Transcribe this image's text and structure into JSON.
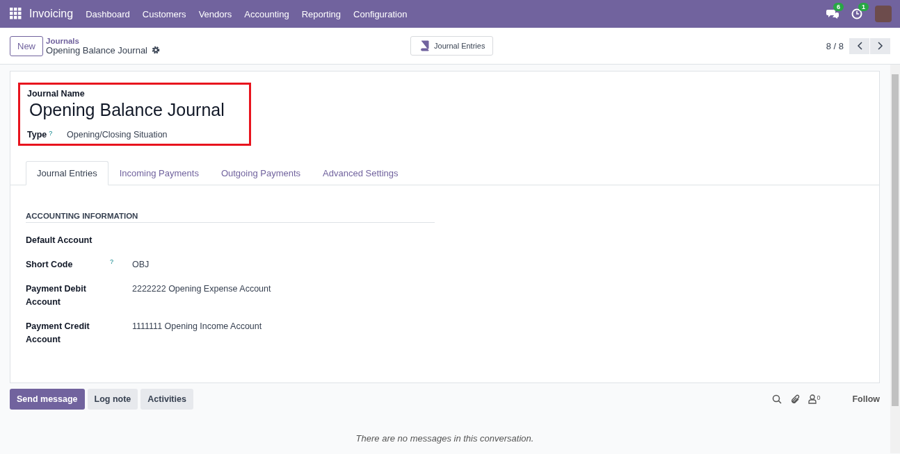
{
  "navbar": {
    "app_name": "Invoicing",
    "menu": [
      "Dashboard",
      "Customers",
      "Vendors",
      "Accounting",
      "Reporting",
      "Configuration"
    ],
    "chat_badge": "6",
    "activity_badge": "1"
  },
  "control_panel": {
    "new_button": "New",
    "breadcrumb_parent": "Journals",
    "breadcrumb_current": "Opening Balance Journal",
    "smart_button": "Journal Entries",
    "pager": "8 / 8"
  },
  "form": {
    "name_label": "Journal Name",
    "name_value": "Opening Balance Journal",
    "type_label": "Type",
    "type_help": "?",
    "type_value": "Opening/Closing Situation",
    "tabs": [
      {
        "label": "Journal Entries",
        "selected": true
      },
      {
        "label": "Incoming Payments",
        "selected": false
      },
      {
        "label": "Outgoing Payments",
        "selected": false
      },
      {
        "label": "Advanced Settings",
        "selected": false
      }
    ],
    "section_title": "ACCOUNTING INFORMATION",
    "fields": [
      {
        "label": "Default Account"
      },
      {
        "label": "Short Code",
        "help": "?",
        "value": "OBJ"
      },
      {
        "label": "Payment Debit Account",
        "value": "2222222 Opening Expense Account"
      },
      {
        "label": "Payment Credit Account",
        "value": "1111111 Opening Income Account"
      }
    ]
  },
  "chatter": {
    "buttons": [
      {
        "label": "Send message",
        "primary": true
      },
      {
        "label": "Log note",
        "primary": false
      },
      {
        "label": "Activities",
        "primary": false
      }
    ],
    "follower_count": "0",
    "follow": "Follow",
    "empty_message": "There are no messages in this conversation."
  }
}
